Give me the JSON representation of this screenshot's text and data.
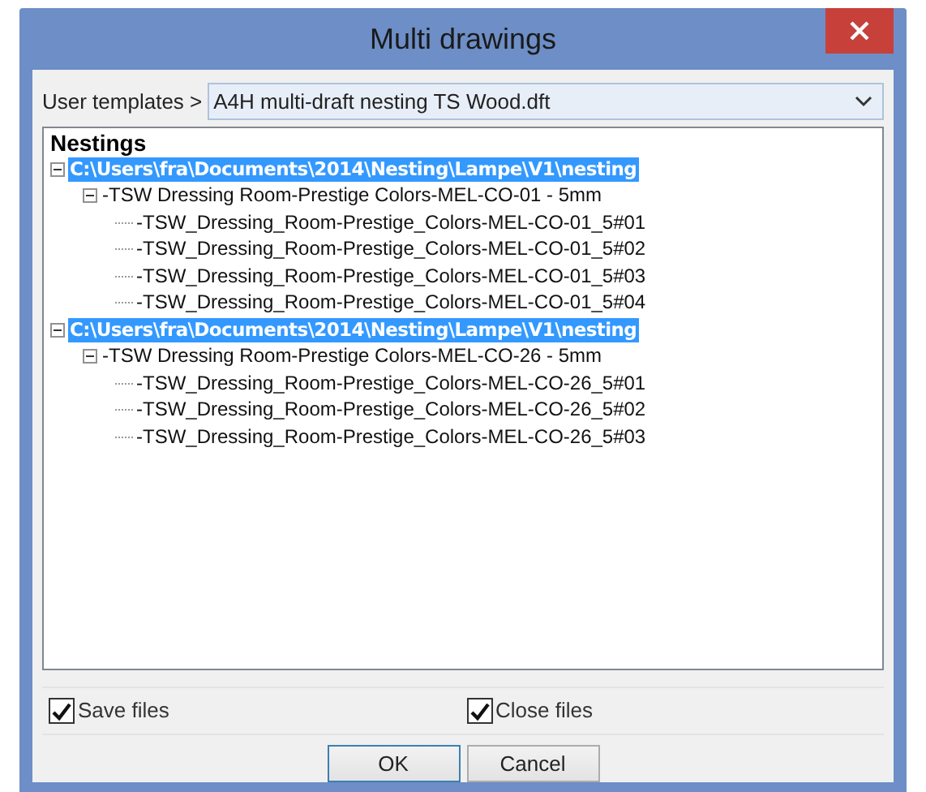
{
  "window": {
    "title": "Multi drawings"
  },
  "template": {
    "label": "User templates >",
    "value": "A4H multi-draft nesting TS Wood.dft"
  },
  "tree": {
    "heading": "Nestings",
    "items": [
      {
        "label": "C:\\Users\\fra\\Documents\\2014\\Nesting\\Lampe\\V1\\nesting",
        "selected": true,
        "expanded": true,
        "children": [
          {
            "label": "-TSW Dressing Room-Prestige Colors-MEL-CO-01 - 5mm",
            "selected": false,
            "expanded": true,
            "children": [
              {
                "label": "-TSW_Dressing_Room-Prestige_Colors-MEL-CO-01_5#01",
                "selected": false
              },
              {
                "label": "-TSW_Dressing_Room-Prestige_Colors-MEL-CO-01_5#02",
                "selected": false
              },
              {
                "label": "-TSW_Dressing_Room-Prestige_Colors-MEL-CO-01_5#03",
                "selected": false
              },
              {
                "label": "-TSW_Dressing_Room-Prestige_Colors-MEL-CO-01_5#04",
                "selected": false
              }
            ]
          }
        ]
      },
      {
        "label": "C:\\Users\\fra\\Documents\\2014\\Nesting\\Lampe\\V1\\nesting",
        "selected": true,
        "expanded": true,
        "children": [
          {
            "label": "-TSW Dressing Room-Prestige Colors-MEL-CO-26 - 5mm",
            "selected": false,
            "expanded": true,
            "children": [
              {
                "label": "-TSW_Dressing_Room-Prestige_Colors-MEL-CO-26_5#01",
                "selected": false
              },
              {
                "label": "-TSW_Dressing_Room-Prestige_Colors-MEL-CO-26_5#02",
                "selected": false
              },
              {
                "label": "-TSW_Dressing_Room-Prestige_Colors-MEL-CO-26_5#03",
                "selected": false
              }
            ]
          }
        ]
      }
    ]
  },
  "options": [
    {
      "label": "Save files",
      "checked": true
    },
    {
      "label": "Close files",
      "checked": true
    }
  ],
  "buttons": [
    {
      "label": "OK",
      "default": true
    },
    {
      "label": "Cancel",
      "default": false
    }
  ]
}
